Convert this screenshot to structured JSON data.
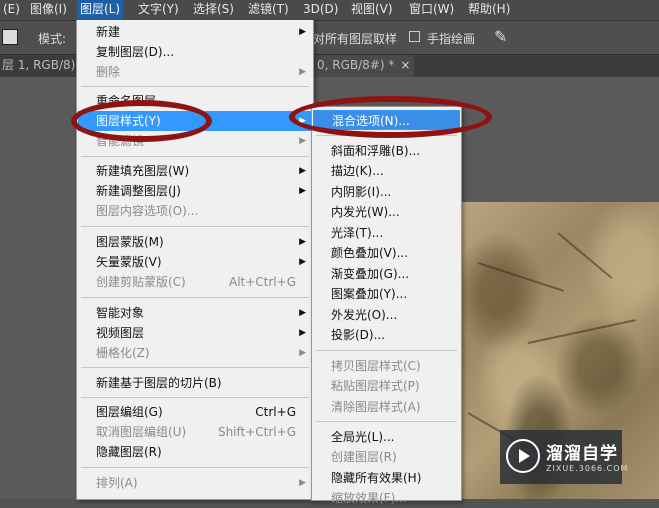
{
  "menubar": [
    {
      "label": "(E)"
    },
    {
      "label": "图像(I)"
    },
    {
      "label": "图层(L)"
    },
    {
      "label": "文字(Y)"
    },
    {
      "label": "选择(S)"
    },
    {
      "label": "滤镜(T)"
    },
    {
      "label": "3D(D)"
    },
    {
      "label": "视图(V)"
    },
    {
      "label": "窗口(W)"
    },
    {
      "label": "帮助(H)"
    }
  ],
  "options": {
    "mode_label": "模式:",
    "sample_all": "对所有图层取样",
    "finger_paint": "手指绘画"
  },
  "tabs": {
    "tab1": "层 1, RGB/8) *",
    "tab2": "0, RGB/8#) *",
    "tab2_close": "×"
  },
  "layer_menu": {
    "items": [
      {
        "label": "新建",
        "shortcut": "",
        "submenu": true,
        "disabled": false
      },
      {
        "label": "复制图层(D)...",
        "shortcut": "",
        "submenu": false,
        "disabled": false
      },
      {
        "label": "删除",
        "shortcut": "",
        "submenu": true,
        "disabled": true
      },
      {
        "label": "重命名图层...",
        "shortcut": "",
        "submenu": false,
        "disabled": false
      },
      {
        "label": "图层样式(Y)",
        "shortcut": "",
        "submenu": true,
        "disabled": false,
        "highlighted": true
      },
      {
        "label": "智能滤镜",
        "shortcut": "",
        "submenu": true,
        "disabled": true
      },
      {
        "label": "新建填充图层(W)",
        "shortcut": "",
        "submenu": true,
        "disabled": false
      },
      {
        "label": "新建调整图层(J)",
        "shortcut": "",
        "submenu": true,
        "disabled": false
      },
      {
        "label": "图层内容选项(O)...",
        "shortcut": "",
        "submenu": false,
        "disabled": true
      },
      {
        "label": "图层蒙版(M)",
        "shortcut": "",
        "submenu": true,
        "disabled": false
      },
      {
        "label": "矢量蒙版(V)",
        "shortcut": "",
        "submenu": true,
        "disabled": false
      },
      {
        "label": "创建剪贴蒙版(C)",
        "shortcut": "Alt+Ctrl+G",
        "submenu": false,
        "disabled": true
      },
      {
        "label": "智能对象",
        "shortcut": "",
        "submenu": true,
        "disabled": false
      },
      {
        "label": "视频图层",
        "shortcut": "",
        "submenu": true,
        "disabled": false
      },
      {
        "label": "栅格化(Z)",
        "shortcut": "",
        "submenu": true,
        "disabled": true
      },
      {
        "label": "新建基于图层的切片(B)",
        "shortcut": "",
        "submenu": false,
        "disabled": false
      },
      {
        "label": "图层编组(G)",
        "shortcut": "Ctrl+G",
        "submenu": false,
        "disabled": false
      },
      {
        "label": "取消图层编组(U)",
        "shortcut": "Shift+Ctrl+G",
        "submenu": false,
        "disabled": true
      },
      {
        "label": "隐藏图层(R)",
        "shortcut": "",
        "submenu": false,
        "disabled": false
      },
      {
        "label": "排列(A)",
        "shortcut": "",
        "submenu": true,
        "disabled": true
      }
    ]
  },
  "style_submenu": {
    "items": [
      {
        "label": "混合选项(N)...",
        "disabled": false,
        "highlighted": true
      },
      {
        "label": "斜面和浮雕(B)...",
        "disabled": false
      },
      {
        "label": "描边(K)...",
        "disabled": false
      },
      {
        "label": "内阴影(I)...",
        "disabled": false
      },
      {
        "label": "内发光(W)...",
        "disabled": false
      },
      {
        "label": "光泽(T)...",
        "disabled": false
      },
      {
        "label": "颜色叠加(V)...",
        "disabled": false
      },
      {
        "label": "渐变叠加(G)...",
        "disabled": false
      },
      {
        "label": "图案叠加(Y)...",
        "disabled": false
      },
      {
        "label": "外发光(O)...",
        "disabled": false
      },
      {
        "label": "投影(D)...",
        "disabled": false
      },
      {
        "label": "拷贝图层样式(C)",
        "disabled": true
      },
      {
        "label": "粘贴图层样式(P)",
        "disabled": true
      },
      {
        "label": "清除图层样式(A)",
        "disabled": true
      },
      {
        "label": "全局光(L)...",
        "disabled": false
      },
      {
        "label": "创建图层(R)",
        "disabled": true
      },
      {
        "label": "隐藏所有效果(H)",
        "disabled": false
      },
      {
        "label": "缩放效果(F)...",
        "disabled": true
      }
    ]
  },
  "watermark": {
    "title": "溜溜自学",
    "url": "ZIXUE.3066.COM"
  },
  "colors": {
    "highlight": "#3399ff",
    "annotation": "#8e1414"
  }
}
